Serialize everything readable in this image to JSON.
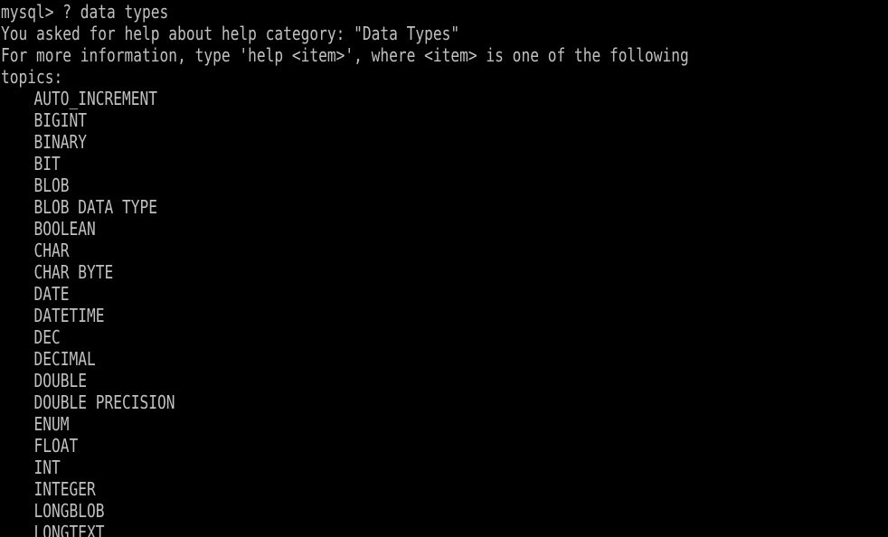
{
  "terminal": {
    "background": "#000000",
    "foreground": "#c0c0c0",
    "prompt_line": "mysql> ? data types",
    "info_line_1": "You asked for help about help category: \"Data Types\"",
    "info_line_2": "For more information, type 'help <item>', where <item> is one of the following",
    "info_line_3": "topics:",
    "topics": [
      "AUTO_INCREMENT",
      "BIGINT",
      "BINARY",
      "BIT",
      "BLOB",
      "BLOB DATA TYPE",
      "BOOLEAN",
      "CHAR",
      "CHAR BYTE",
      "DATE",
      "DATETIME",
      "DEC",
      "DECIMAL",
      "DOUBLE",
      "DOUBLE PRECISION",
      "ENUM",
      "FLOAT",
      "INT",
      "INTEGER",
      "LONGBLOB",
      "LONGTEXT"
    ]
  }
}
